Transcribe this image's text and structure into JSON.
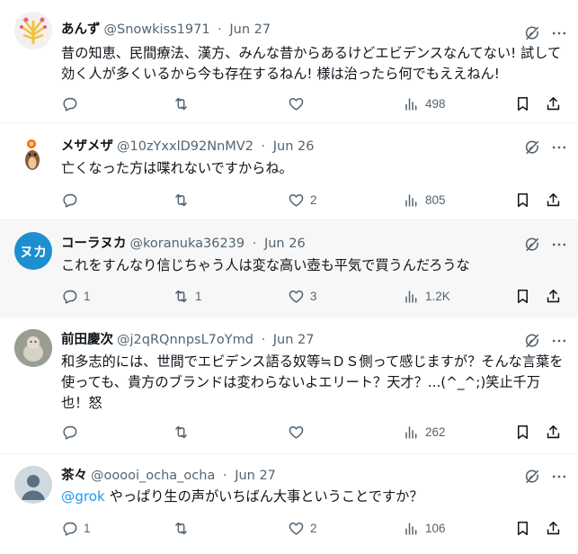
{
  "tweets": [
    {
      "name": "あんず",
      "handle": "@Snowkiss1971",
      "sep": "·",
      "date": "Jun 27",
      "text": "昔の知恵、民間療法、漢方、みんな昔からあるけどエビデンスなんてない! 試して効く人が多くいるから今も存在するねん! 様は治ったら何でもええねん!",
      "replies": "",
      "retweets": "",
      "likes": "",
      "views": "498"
    },
    {
      "name": "メザメザ",
      "handle": "@10zYxxlD92NnMV2",
      "sep": "·",
      "date": "Jun 26",
      "text": "亡くなった方は喋れないですからね。",
      "replies": "",
      "retweets": "",
      "likes": "2",
      "views": "805"
    },
    {
      "name": "コーラヌカ",
      "handle": "@koranuka36239",
      "sep": "·",
      "date": "Jun 26",
      "avatar_text": "ヌカ",
      "text": "これをすんなり信じちゃう人は変な高い壺も平気で買うんだろうな",
      "replies": "1",
      "retweets": "1",
      "likes": "3",
      "views": "1.2K"
    },
    {
      "name": "前田慶次",
      "handle": "@j2qRQnnpsL7oYmd",
      "sep": "·",
      "date": "Jun 27",
      "text": "和多志的には、世間でエビデンス語る奴等≒ＤＳ側って感じますが？そんな言葉を使っても、貴方のブランドは変わらないよエリート？天才？...(^_^;)笑止千万也！怒",
      "replies": "",
      "retweets": "",
      "likes": "",
      "views": "262"
    },
    {
      "name": "茶々",
      "handle": "@ooooi_ocha_ocha",
      "sep": "·",
      "date": "Jun 27",
      "mention": "@grok",
      "text": " やっぱり生の声がいちばん大事ということですか？",
      "replies": "1",
      "retweets": "",
      "likes": "2",
      "views": "106"
    }
  ],
  "icons": {
    "reply": "reply-icon",
    "retweet": "retweet-icon",
    "like": "heart-icon",
    "views": "views-icon",
    "bookmark": "bookmark-icon",
    "share": "share-icon",
    "grok": "grok-icon",
    "more": "more-icon"
  },
  "colors": {
    "link": "#1d9bf0",
    "secondary_text": "#536471",
    "koranuka_avatar": "#1d8fd1"
  }
}
